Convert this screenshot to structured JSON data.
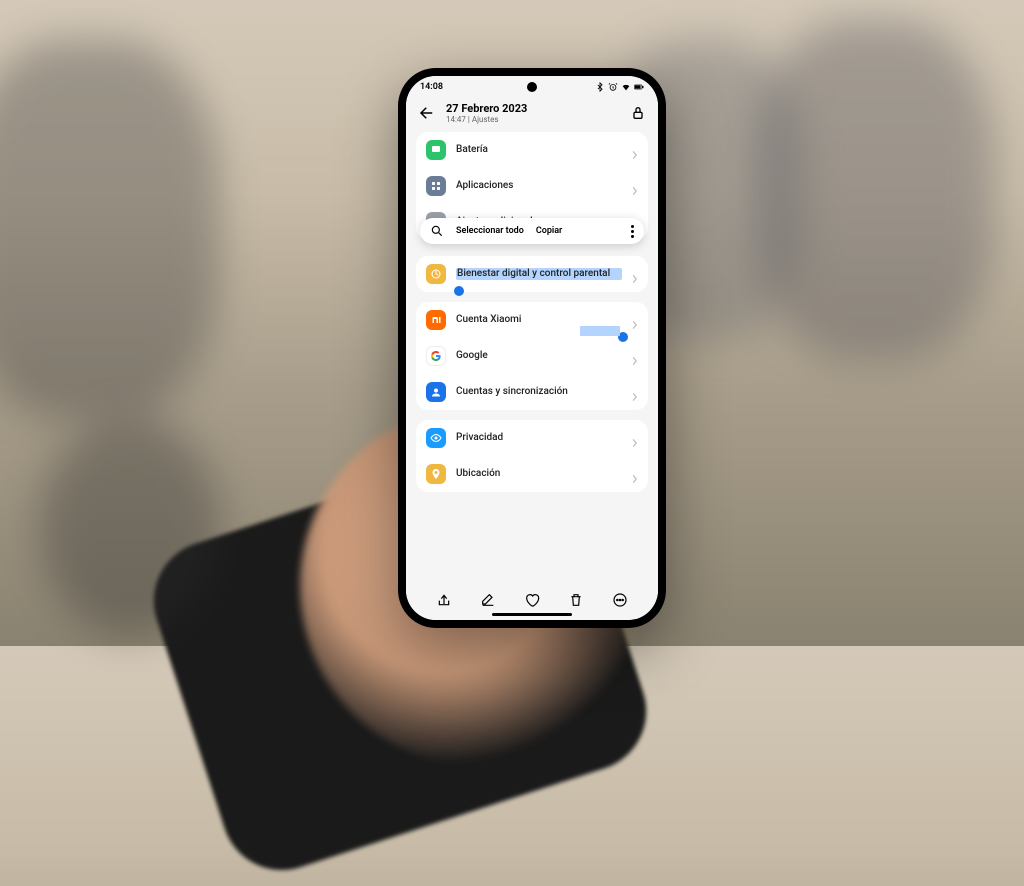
{
  "status": {
    "time": "14:08"
  },
  "header": {
    "title": "27 Febrero 2023",
    "subtitle": "14:47 | Ajustes"
  },
  "context_menu": {
    "select_all": "Seleccionar todo",
    "copy": "Copiar"
  },
  "groups": [
    {
      "rows": [
        {
          "icon": "battery",
          "color": "#2cc46a",
          "label": "Batería"
        },
        {
          "icon": "apps",
          "color": "#6b7c99",
          "label": "Aplicaciones"
        },
        {
          "icon": "more-settings",
          "color": "#9aa0a8",
          "label": "Ajustes adicionales"
        }
      ]
    },
    {
      "rows": [
        {
          "icon": "wellbeing",
          "color": "#f0b840",
          "label": "Bienestar digital y control parental",
          "selected": true
        }
      ]
    },
    {
      "rows": [
        {
          "icon": "xiaomi",
          "color": "#ff6b00",
          "label": "Cuenta Xiaomi",
          "sel_end": true
        },
        {
          "icon": "google",
          "color": "#ffffff",
          "label": "Google"
        },
        {
          "icon": "accounts",
          "color": "#1a73e8",
          "label": "Cuentas y sincronización"
        }
      ]
    },
    {
      "rows": [
        {
          "icon": "privacy",
          "color": "#1a9cff",
          "label": "Privacidad"
        },
        {
          "icon": "location",
          "color": "#f0b840",
          "label": "Ubicación"
        }
      ]
    }
  ]
}
